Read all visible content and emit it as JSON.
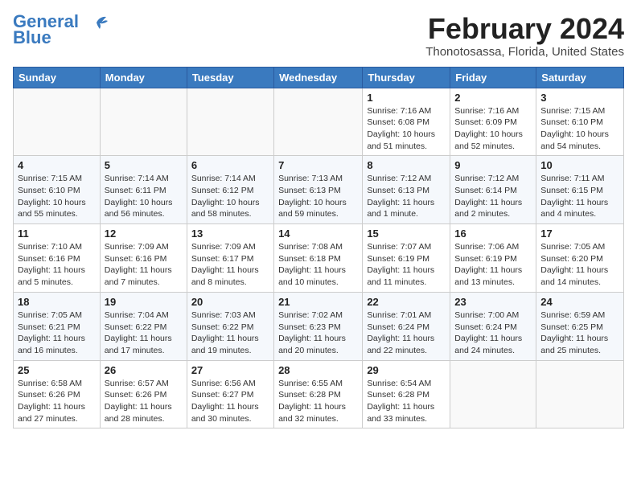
{
  "logo": {
    "line1": "General",
    "line2": "Blue"
  },
  "title": "February 2024",
  "location": "Thonotosassa, Florida, United States",
  "weekdays": [
    "Sunday",
    "Monday",
    "Tuesday",
    "Wednesday",
    "Thursday",
    "Friday",
    "Saturday"
  ],
  "weeks": [
    [
      {
        "day": "",
        "info": ""
      },
      {
        "day": "",
        "info": ""
      },
      {
        "day": "",
        "info": ""
      },
      {
        "day": "",
        "info": ""
      },
      {
        "day": "1",
        "info": "Sunrise: 7:16 AM\nSunset: 6:08 PM\nDaylight: 10 hours\nand 51 minutes."
      },
      {
        "day": "2",
        "info": "Sunrise: 7:16 AM\nSunset: 6:09 PM\nDaylight: 10 hours\nand 52 minutes."
      },
      {
        "day": "3",
        "info": "Sunrise: 7:15 AM\nSunset: 6:10 PM\nDaylight: 10 hours\nand 54 minutes."
      }
    ],
    [
      {
        "day": "4",
        "info": "Sunrise: 7:15 AM\nSunset: 6:10 PM\nDaylight: 10 hours\nand 55 minutes."
      },
      {
        "day": "5",
        "info": "Sunrise: 7:14 AM\nSunset: 6:11 PM\nDaylight: 10 hours\nand 56 minutes."
      },
      {
        "day": "6",
        "info": "Sunrise: 7:14 AM\nSunset: 6:12 PM\nDaylight: 10 hours\nand 58 minutes."
      },
      {
        "day": "7",
        "info": "Sunrise: 7:13 AM\nSunset: 6:13 PM\nDaylight: 10 hours\nand 59 minutes."
      },
      {
        "day": "8",
        "info": "Sunrise: 7:12 AM\nSunset: 6:13 PM\nDaylight: 11 hours\nand 1 minute."
      },
      {
        "day": "9",
        "info": "Sunrise: 7:12 AM\nSunset: 6:14 PM\nDaylight: 11 hours\nand 2 minutes."
      },
      {
        "day": "10",
        "info": "Sunrise: 7:11 AM\nSunset: 6:15 PM\nDaylight: 11 hours\nand 4 minutes."
      }
    ],
    [
      {
        "day": "11",
        "info": "Sunrise: 7:10 AM\nSunset: 6:16 PM\nDaylight: 11 hours\nand 5 minutes."
      },
      {
        "day": "12",
        "info": "Sunrise: 7:09 AM\nSunset: 6:16 PM\nDaylight: 11 hours\nand 7 minutes."
      },
      {
        "day": "13",
        "info": "Sunrise: 7:09 AM\nSunset: 6:17 PM\nDaylight: 11 hours\nand 8 minutes."
      },
      {
        "day": "14",
        "info": "Sunrise: 7:08 AM\nSunset: 6:18 PM\nDaylight: 11 hours\nand 10 minutes."
      },
      {
        "day": "15",
        "info": "Sunrise: 7:07 AM\nSunset: 6:19 PM\nDaylight: 11 hours\nand 11 minutes."
      },
      {
        "day": "16",
        "info": "Sunrise: 7:06 AM\nSunset: 6:19 PM\nDaylight: 11 hours\nand 13 minutes."
      },
      {
        "day": "17",
        "info": "Sunrise: 7:05 AM\nSunset: 6:20 PM\nDaylight: 11 hours\nand 14 minutes."
      }
    ],
    [
      {
        "day": "18",
        "info": "Sunrise: 7:05 AM\nSunset: 6:21 PM\nDaylight: 11 hours\nand 16 minutes."
      },
      {
        "day": "19",
        "info": "Sunrise: 7:04 AM\nSunset: 6:22 PM\nDaylight: 11 hours\nand 17 minutes."
      },
      {
        "day": "20",
        "info": "Sunrise: 7:03 AM\nSunset: 6:22 PM\nDaylight: 11 hours\nand 19 minutes."
      },
      {
        "day": "21",
        "info": "Sunrise: 7:02 AM\nSunset: 6:23 PM\nDaylight: 11 hours\nand 20 minutes."
      },
      {
        "day": "22",
        "info": "Sunrise: 7:01 AM\nSunset: 6:24 PM\nDaylight: 11 hours\nand 22 minutes."
      },
      {
        "day": "23",
        "info": "Sunrise: 7:00 AM\nSunset: 6:24 PM\nDaylight: 11 hours\nand 24 minutes."
      },
      {
        "day": "24",
        "info": "Sunrise: 6:59 AM\nSunset: 6:25 PM\nDaylight: 11 hours\nand 25 minutes."
      }
    ],
    [
      {
        "day": "25",
        "info": "Sunrise: 6:58 AM\nSunset: 6:26 PM\nDaylight: 11 hours\nand 27 minutes."
      },
      {
        "day": "26",
        "info": "Sunrise: 6:57 AM\nSunset: 6:26 PM\nDaylight: 11 hours\nand 28 minutes."
      },
      {
        "day": "27",
        "info": "Sunrise: 6:56 AM\nSunset: 6:27 PM\nDaylight: 11 hours\nand 30 minutes."
      },
      {
        "day": "28",
        "info": "Sunrise: 6:55 AM\nSunset: 6:28 PM\nDaylight: 11 hours\nand 32 minutes."
      },
      {
        "day": "29",
        "info": "Sunrise: 6:54 AM\nSunset: 6:28 PM\nDaylight: 11 hours\nand 33 minutes."
      },
      {
        "day": "",
        "info": ""
      },
      {
        "day": "",
        "info": ""
      }
    ]
  ]
}
